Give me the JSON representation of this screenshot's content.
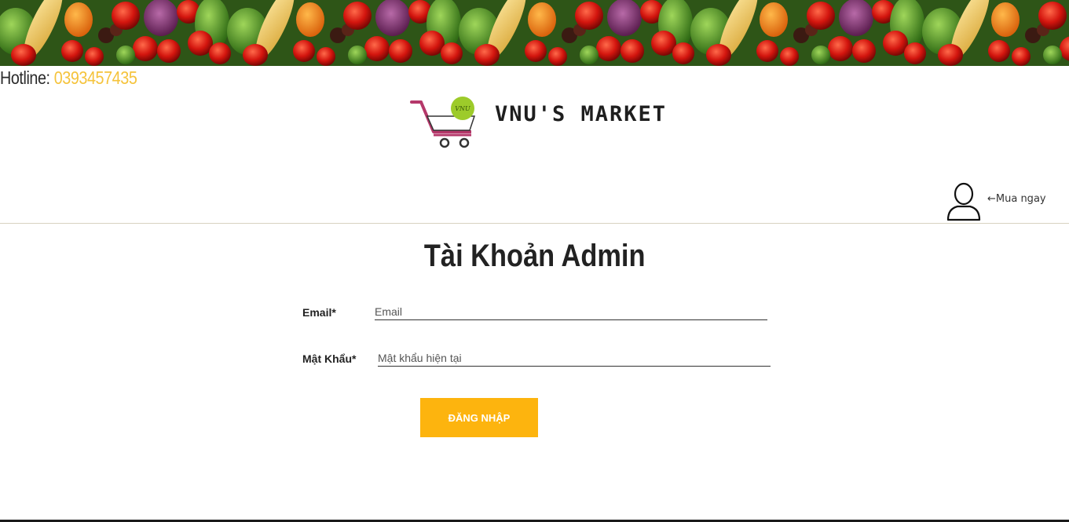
{
  "header": {
    "hotline_label": "Hotline: ",
    "hotline_number": "0393457435",
    "logo_text": "VNU'S MARKET",
    "logo_badge": "VNU"
  },
  "user_menu": {
    "icon": "user-icon",
    "label": "←Mua ngay"
  },
  "main": {
    "title": "Tài Khoản Admin",
    "email_label": "Email*",
    "email_placeholder": "Email",
    "email_value": "",
    "password_label": "Mật Khẩu*",
    "password_placeholder": "Mật khẩu hiện tại",
    "password_value": "",
    "login_button": "ĐĂNG NHẬP"
  },
  "colors": {
    "accent": "#fdb40e",
    "hotline_number": "#f5c33b",
    "cart": "#b5386a",
    "badge": "#9dcb2a"
  }
}
